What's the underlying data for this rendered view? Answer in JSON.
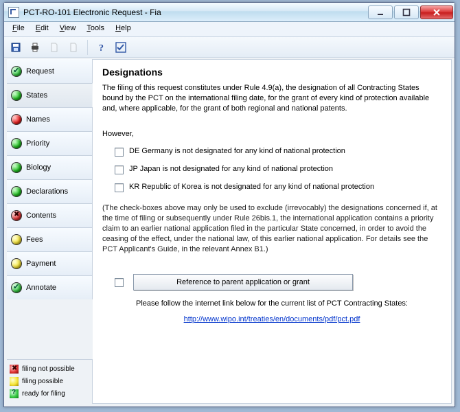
{
  "title": "PCT-RO-101 Electronic Request - Fia",
  "menu": {
    "file": "File",
    "edit": "Edit",
    "view": "View",
    "tools": "Tools",
    "help": "Help"
  },
  "sidebar": {
    "items": [
      {
        "label": "Request"
      },
      {
        "label": "States"
      },
      {
        "label": "Names"
      },
      {
        "label": "Priority"
      },
      {
        "label": "Biology"
      },
      {
        "label": "Declarations"
      },
      {
        "label": "Contents"
      },
      {
        "label": "Fees"
      },
      {
        "label": "Payment"
      },
      {
        "label": "Annotate"
      }
    ],
    "legend": {
      "not": "filing not possible",
      "ok": "filing possible",
      "ready": "ready for filing"
    }
  },
  "main": {
    "heading": "Designations",
    "intro": "The filing of this request constitutes under Rule 4.9(a), the designation of all Contracting States bound by the PCT on the international filing date, for the grant of every kind of protection available and, where applicable, for the grant of both regional and national patents.",
    "however": "However,",
    "checks": [
      "DE Germany is not designated for any kind of national protection",
      "JP Japan is not designated for any kind of national protection",
      "KR Republic of Korea is not designated for any kind of national protection"
    ],
    "note": "(The check-boxes above may only be used to exclude (irrevocably) the designations concerned if, at the time of filing or subsequently under Rule 26bis.1, the international application contains a priority claim to an earlier national application filed in the particular State concerned, in order to avoid the ceasing of the effect, under the national law, of this earlier national application. For details see the PCT Applicant's Guide, in the relevant Annex B1.)",
    "ref_btn": "Reference to parent application or grant",
    "foot": "Please follow the internet link below for the current list of PCT Contracting States:",
    "link": "http://www.wipo.int/treaties/en/documents/pdf/pct.pdf"
  }
}
